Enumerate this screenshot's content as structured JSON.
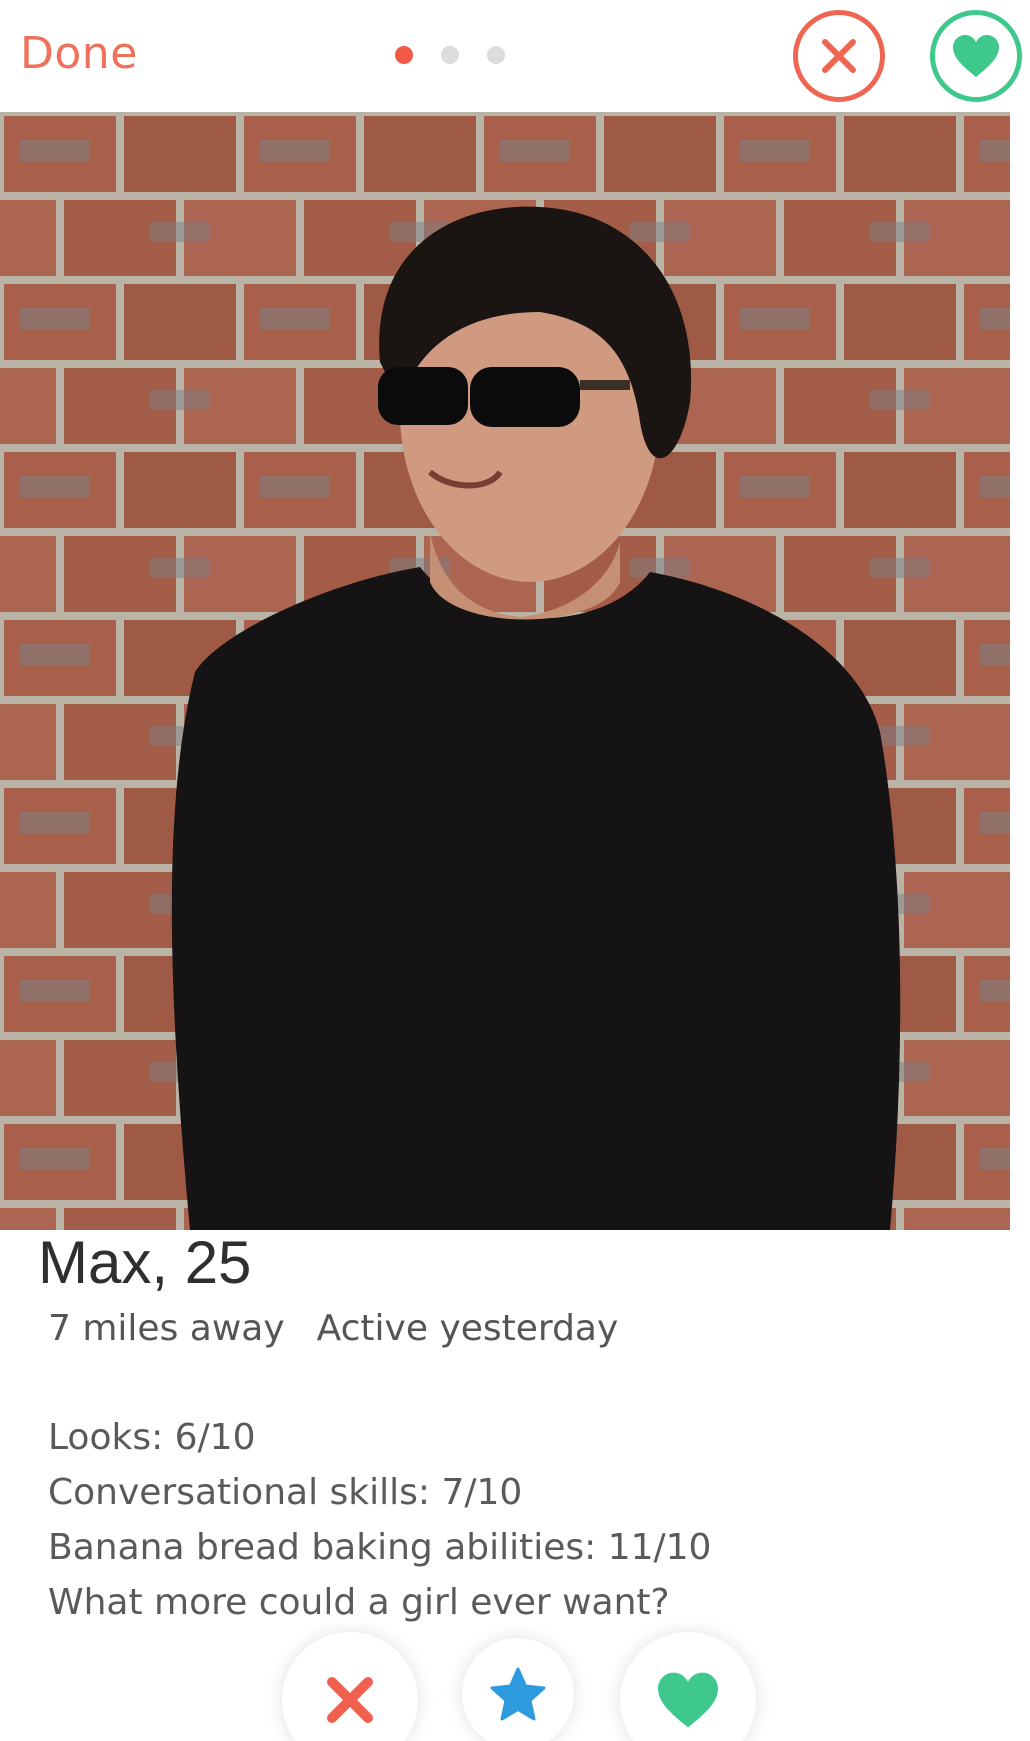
{
  "header": {
    "done_label": "Done",
    "page_dots": {
      "total": 3,
      "active": 1
    },
    "nope_icon": "close-circle-icon",
    "like_icon": "heart-circle-icon"
  },
  "profile": {
    "name_age": "Max, 25",
    "distance": "7 miles away",
    "activity": "Active yesterday",
    "bio": [
      "Looks: 6/10",
      "Conversational skills: 7/10",
      "Banana bread baking abilities: 11/10",
      "What more could a girl ever want?"
    ]
  },
  "actions": {
    "nope_icon": "x-icon",
    "super_like_icon": "star-icon",
    "like_icon": "heart-icon"
  },
  "colors": {
    "nope": "#f0604e",
    "like": "#3fc88b",
    "super_like": "#2f9bdf",
    "brick": "#a9614b",
    "mortar": "#b9b4a6"
  }
}
